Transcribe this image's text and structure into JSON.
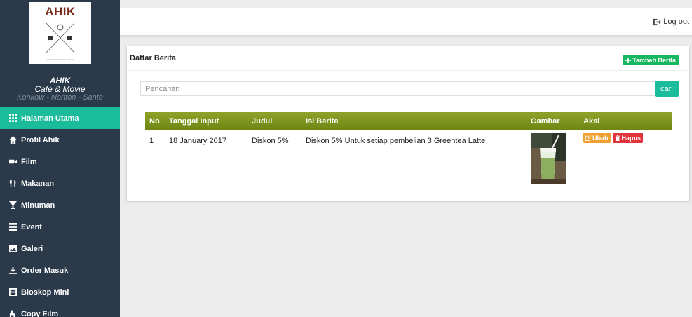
{
  "sidebar": {
    "logo_text": "AHIK",
    "logo_tagline": "KONKOW NONTON SANTE",
    "brand_name": "AHIK",
    "brand_sub": "Cafe & Movie",
    "brand_slogan": "Konkow - Nonton - Sante",
    "active_item": "Halaman Utama",
    "items": [
      {
        "label": "Halaman Utama",
        "icon": "grid-icon"
      },
      {
        "label": "Profil Ahik",
        "icon": "home-icon"
      },
      {
        "label": "Film",
        "icon": "video-icon"
      },
      {
        "label": "Makanan",
        "icon": "cutlery-icon"
      },
      {
        "label": "Minuman",
        "icon": "glass-icon"
      },
      {
        "label": "Event",
        "icon": "list-icon"
      },
      {
        "label": "Galeri",
        "icon": "picture-icon"
      },
      {
        "label": "Order Masuk",
        "icon": "download-icon"
      },
      {
        "label": "Bioskop Mini",
        "icon": "film-icon"
      },
      {
        "label": "Copy Film",
        "icon": "copy-icon"
      }
    ]
  },
  "header": {
    "logout_label": "Log out"
  },
  "panel": {
    "title": "Daftar Berita",
    "add_button_label": "Tambah Berita"
  },
  "search": {
    "placeholder": "Pencarian",
    "button_label": "cari"
  },
  "table": {
    "columns": [
      "No",
      "Tanggal Input",
      "Judul",
      "Isi Berita",
      "Gambar",
      "Aksi"
    ],
    "rows": [
      {
        "no": "1",
        "tanggal": "18 January 2017",
        "judul": "Diskon 5%",
        "isi": "Diskon 5% Untuk setiap pembelian 3 Greentea Latte",
        "image": "greentea-latte-photo",
        "edit_label": "Ubah",
        "delete_label": "Hapus"
      }
    ]
  },
  "colors": {
    "sidebar_bg": "#2b3a4a",
    "accent": "#1abc9c",
    "table_header": "#7d9320",
    "add_button": "#18b860",
    "edit_button": "#f0a030",
    "delete_button": "#e0333c"
  }
}
